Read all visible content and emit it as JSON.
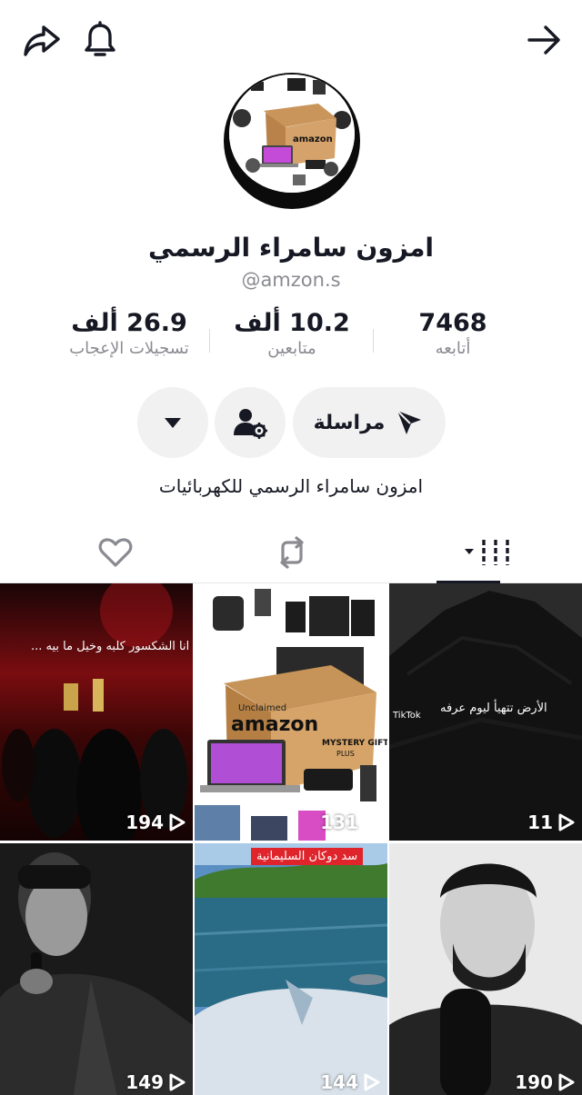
{
  "profile": {
    "display_name": "امزون سامراء الرسمي",
    "handle": "@amzon.s",
    "bio": "امزون سامراء الرسمي للكهربائيات",
    "avatar_text": "amazon"
  },
  "stats": {
    "following": {
      "value": "7468",
      "label": "أتابعه"
    },
    "followers": {
      "value": "10.2 ألف",
      "label": "متابعين"
    },
    "likes": {
      "value": "26.9 ألف",
      "label": "تسجيلات الإعجاب"
    }
  },
  "actions": {
    "message_label": "مراسلة"
  },
  "tabs": [
    {
      "name": "videos",
      "active": true
    },
    {
      "name": "reposts",
      "active": false
    },
    {
      "name": "liked",
      "active": false
    }
  ],
  "videos": [
    {
      "views": "194",
      "caption": "انا الشكسور كلبه وخيل ما بيه ..."
    },
    {
      "views": "131",
      "box_text": "amazon",
      "box_small": "Unclaimed",
      "box_gifts": "MYSTERY GIFTS",
      "box_plus": "PLUS"
    },
    {
      "views": "11",
      "caption": "الأرض تتهيأ ليوم عرفه",
      "watermark": "TikTok"
    },
    {
      "views": "149"
    },
    {
      "views": "144",
      "banner": "سد دوكان السليمانية"
    },
    {
      "views": "190"
    }
  ],
  "colors": {
    "text": "#161823",
    "muted": "#8a8b91",
    "button_bg": "#f1f1f2"
  }
}
